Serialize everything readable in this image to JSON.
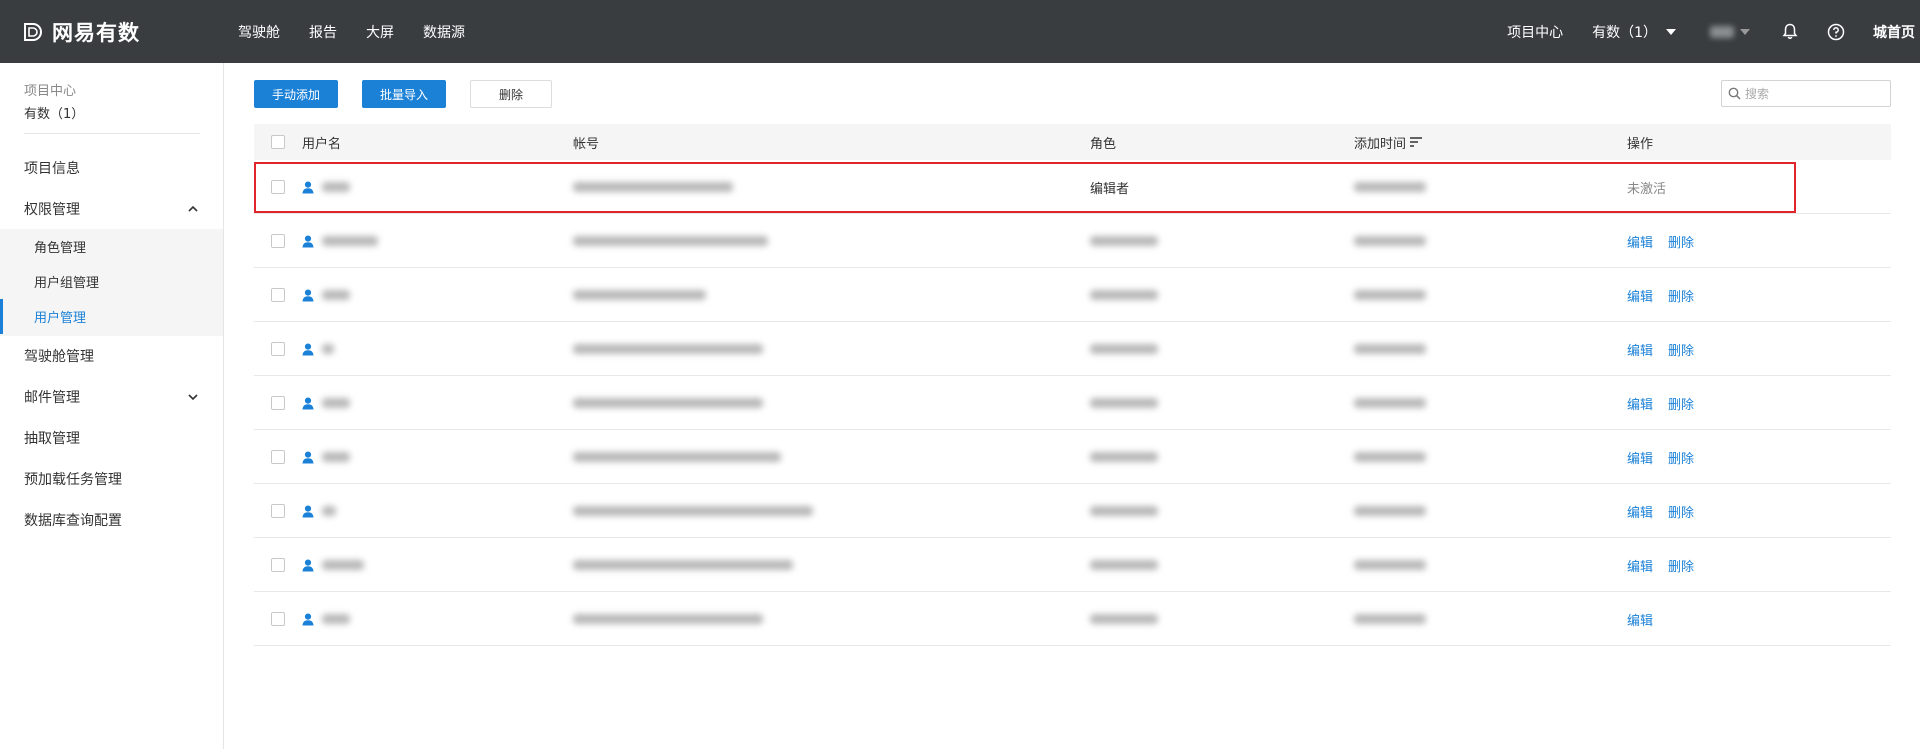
{
  "app": {
    "logo_text": "网易有数"
  },
  "topnav": [
    "驾驶舱",
    "报告",
    "大屏",
    "数据源"
  ],
  "topright": {
    "project_center": "项目中心",
    "project_select": "有数（1）",
    "home_link": "城首页"
  },
  "sidebar": {
    "header_label": "项目中心",
    "header_value": "有数（1）",
    "items": [
      {
        "label": "项目信息"
      },
      {
        "label": "权限管理",
        "expanded": true
      },
      {
        "label": "驾驶舱管理"
      },
      {
        "label": "邮件管理",
        "expanded": false
      },
      {
        "label": "抽取管理"
      },
      {
        "label": "预加载任务管理"
      },
      {
        "label": "数据库查询配置"
      }
    ],
    "sub_items": [
      {
        "label": "角色管理"
      },
      {
        "label": "用户组管理"
      },
      {
        "label": "用户管理",
        "active": true
      }
    ]
  },
  "toolbar": {
    "manual_add": "手动添加",
    "batch_import": "批量导入",
    "delete": "删除"
  },
  "search": {
    "placeholder": "搜索"
  },
  "table": {
    "headers": {
      "username": "用户名",
      "account": "帐号",
      "role": "角色",
      "added_time": "添加时间",
      "actions": "操作"
    },
    "rows": [
      {
        "role": "编辑者",
        "status": "未激活",
        "actions": []
      },
      {
        "actions": [
          "编辑",
          "删除"
        ]
      },
      {
        "actions": [
          "编辑",
          "删除"
        ]
      },
      {
        "actions": [
          "编辑",
          "删除"
        ]
      },
      {
        "actions": [
          "编辑",
          "删除"
        ]
      },
      {
        "actions": [
          "编辑",
          "删除"
        ]
      },
      {
        "actions": [
          "编辑",
          "删除"
        ]
      },
      {
        "actions": [
          "编辑",
          "删除"
        ]
      },
      {
        "actions": [
          "编辑"
        ]
      }
    ]
  },
  "colors": {
    "topbar": "#393d40",
    "accent": "#1b81d7",
    "highlight": "#e0262a"
  }
}
